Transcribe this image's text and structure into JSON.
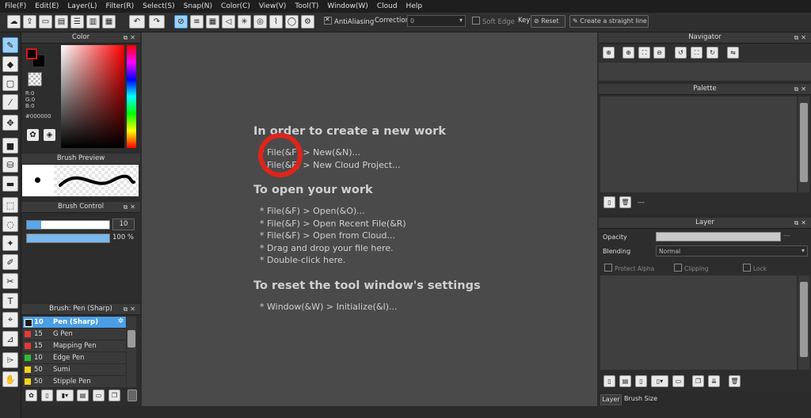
{
  "menu": [
    "File(F)",
    "Edit(E)",
    "Layer(L)",
    "Filter(R)",
    "Select(S)",
    "Snap(N)",
    "Color(C)",
    "View(V)",
    "Tool(T)",
    "Window(W)",
    "Cloud",
    "Help"
  ],
  "toolbar": {
    "antialiasing_label": "AntiAliasing",
    "correction_label": "Correction",
    "correction_value": "0",
    "soft_edge_label": "Soft Edge",
    "key_label": "Key",
    "reset_label": "Reset",
    "straight_line_label": "Create a straight line"
  },
  "color_panel": {
    "title": "Color",
    "r": "R:0",
    "g": "G:0",
    "b": "B:0",
    "hex": "#000000",
    "fg_color": "#000000",
    "accent": "#d51a1a"
  },
  "brush_preview": {
    "title": "Brush Preview"
  },
  "brush_control": {
    "title": "Brush Control",
    "size_value": "10",
    "opacity_value": "100 %"
  },
  "brush_list": {
    "title": "Brush: Pen (Sharp)",
    "items": [
      {
        "size": "10",
        "name": "Pen (Sharp)",
        "color": "#1b1b1b",
        "selected": true
      },
      {
        "size": "15",
        "name": "G Pen",
        "color": "#e53935"
      },
      {
        "size": "15",
        "name": "Mapping Pen",
        "color": "#e53935"
      },
      {
        "size": "10",
        "name": "Edge Pen",
        "color": "#2fbf2f"
      },
      {
        "size": "50",
        "name": "Sumi",
        "color": "#f2d21b"
      },
      {
        "size": "50",
        "name": "Stipple Pen",
        "color": "#f2d21b"
      }
    ]
  },
  "canvas": {
    "new_heading": "In order to create a new work",
    "new_line1": "* File(&F) > New(&N)...",
    "new_line2": "* File(&F) > New Cloud Project...",
    "open_heading": "To open your work",
    "open_line1": "* File(&F) > Open(&O)...",
    "open_line2": "* File(&F) > Open Recent File(&R)",
    "open_line3": "* File(&F) > Open from Cloud...",
    "open_line4": "* Drag and drop your file here.",
    "open_line5": "* Double-click here.",
    "reset_heading": "To reset the tool window's settings",
    "reset_line1": "* Window(&W) > Initialize(&I)..."
  },
  "navigator": {
    "title": "Navigator"
  },
  "palette": {
    "title": "Palette",
    "footer_text": "---"
  },
  "layer": {
    "title": "Layer",
    "opacity_label": "Opacity",
    "opacity_value": "---",
    "blending_label": "Blending",
    "blending_value": "Normal",
    "protect_alpha": "Protect Alpha",
    "clipping": "Clipping",
    "lock": "Lock"
  },
  "bottom_tabs": [
    "Layer",
    "Brush Size"
  ]
}
